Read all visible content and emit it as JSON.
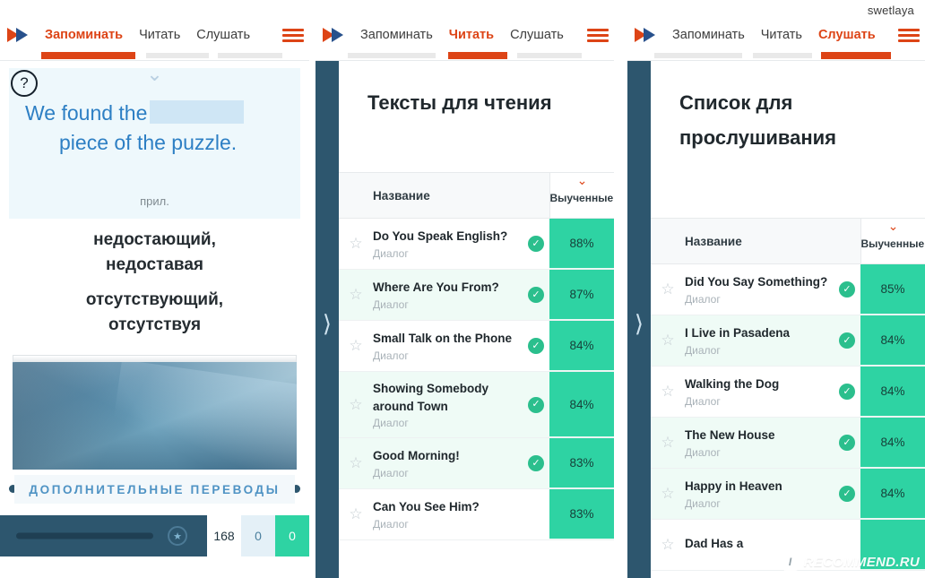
{
  "account": {
    "username": "swetlaya"
  },
  "nav": {
    "logo_icon": "double-triangle-play-icon",
    "menu_icon": "hamburger-menu-icon",
    "tabs": [
      {
        "label": "Запоминать",
        "id": "memorize"
      },
      {
        "label": "Читать",
        "id": "read"
      },
      {
        "label": "Слушать",
        "id": "listen"
      }
    ],
    "active": {
      "panel1": "Запоминать",
      "panel2": "Читать",
      "panel3": "Слушать"
    }
  },
  "panel1": {
    "help_icon": "question-mark-icon",
    "collapse_icon": "chevron-down-icon",
    "sentence_line1": "We found the",
    "sentence_blank": "",
    "sentence_line2": "piece of the puzzle.",
    "part_of_speech": "прил.",
    "translations": [
      [
        "недостающий,",
        "недоставая"
      ],
      [
        "отсутствующий,",
        "отсутствуя"
      ]
    ],
    "image_name": "mountain-photo",
    "extra_translations_label": "ДОПОЛНИТЕЛЬНЫЕ ПЕРЕВОДЫ",
    "badge_icon": "award-badge-icon",
    "counters": [
      {
        "value": "168",
        "style": "white"
      },
      {
        "value": "0",
        "style": "pale"
      },
      {
        "value": "0",
        "style": "green"
      }
    ]
  },
  "panel2": {
    "title": "Тексты для чтения",
    "columns": {
      "name": "Название",
      "learned": "Выученные слова"
    },
    "sort_icon": "chevron-down-icon",
    "rows": [
      {
        "title": "Do You Speak English?",
        "sub": "Диалог",
        "checked": true,
        "pct": "88%"
      },
      {
        "title": "Where Are You From?",
        "sub": "Диалог",
        "checked": true,
        "pct": "87%"
      },
      {
        "title": "Small Talk on the Phone",
        "sub": "Диалог",
        "checked": true,
        "pct": "84%"
      },
      {
        "title": "Showing Somebody around Town",
        "sub": "Диалог",
        "checked": true,
        "pct": "84%"
      },
      {
        "title": "Good Morning!",
        "sub": "Диалог",
        "checked": true,
        "pct": "83%"
      },
      {
        "title": "Can You See Him?",
        "sub": "Диалог",
        "checked": false,
        "pct": "83%"
      }
    ]
  },
  "panel3": {
    "title": "Список для прослушивания",
    "columns": {
      "name": "Название",
      "learned": "Выученные слова"
    },
    "sort_icon": "chevron-down-icon",
    "rows": [
      {
        "title": "Did You Say Something?",
        "sub": "Диалог",
        "checked": true,
        "pct": "85%"
      },
      {
        "title": "I Live in Pasadena",
        "sub": "Диалог",
        "checked": true,
        "pct": "84%"
      },
      {
        "title": "Walking the Dog",
        "sub": "Диалог",
        "checked": true,
        "pct": "84%"
      },
      {
        "title": "The New House",
        "sub": "Диалог",
        "checked": true,
        "pct": "84%"
      },
      {
        "title": "Happy in Heaven",
        "sub": "Диалог",
        "checked": true,
        "pct": "84%"
      },
      {
        "title": "Dad Has a",
        "sub": "",
        "checked": false,
        "pct": ""
      }
    ]
  },
  "watermark": {
    "badge": "I",
    "text": "RECOMMEND.RU"
  },
  "colors": {
    "accent_red": "#dd4416",
    "dark_blue": "#2d566e",
    "green": "#2ed3a3",
    "link_blue": "#2d7fc4"
  }
}
